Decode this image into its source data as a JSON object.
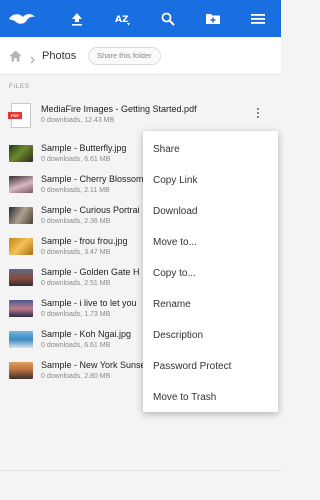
{
  "breadcrumb": {
    "home_icon": "home-icon",
    "separator_icon": "chevron-right-icon",
    "folder": "Photos",
    "share_button": "Share this folder"
  },
  "toolbar": {
    "icons": [
      "mediafire-logo",
      "upload-icon",
      "sort-az-icon",
      "search-icon",
      "add-folder-icon",
      "menu-icon"
    ]
  },
  "section_label": "FILES",
  "files": [
    {
      "name": "MediaFire Images - Getting Started.pdf",
      "meta": "0 downloads, 12.43 MB",
      "kind": "pdf"
    },
    {
      "name": "Sample - Butterfly.jpg",
      "meta": "0 downloads, 6.61 MB",
      "kind": "image"
    },
    {
      "name": "Sample - Cherry Blossom",
      "meta": "0 downloads, 2.11 MB",
      "kind": "image"
    },
    {
      "name": "Sample - Curious Portrai",
      "meta": "0 downloads, 2.36 MB",
      "kind": "image"
    },
    {
      "name": "Sample - frou frou.jpg",
      "meta": "0 downloads, 3.47 MB",
      "kind": "image"
    },
    {
      "name": "Sample - Golden Gate H",
      "meta": "0 downloads, 2.51 MB",
      "kind": "image"
    },
    {
      "name": "Sample - i live to let you",
      "meta": "0 downloads, 1.73 MB",
      "kind": "image"
    },
    {
      "name": "Sample - Koh Ngai.jpg",
      "meta": "0 downloads, 6.61 MB",
      "kind": "image"
    },
    {
      "name": "Sample - New York Sunset - HDR.jpg",
      "meta": "0 downloads, 2.80 MB",
      "kind": "image"
    }
  ],
  "context_menu": {
    "items": [
      "Share",
      "Copy Link",
      "Download",
      "Move to...",
      "Copy to...",
      "Rename",
      "Description",
      "Password Protect",
      "Move to Trash"
    ]
  },
  "colors": {
    "app_bar": "#1a6fe0",
    "menu_bg": "#ffffff",
    "pdf_red": "#e53935"
  }
}
